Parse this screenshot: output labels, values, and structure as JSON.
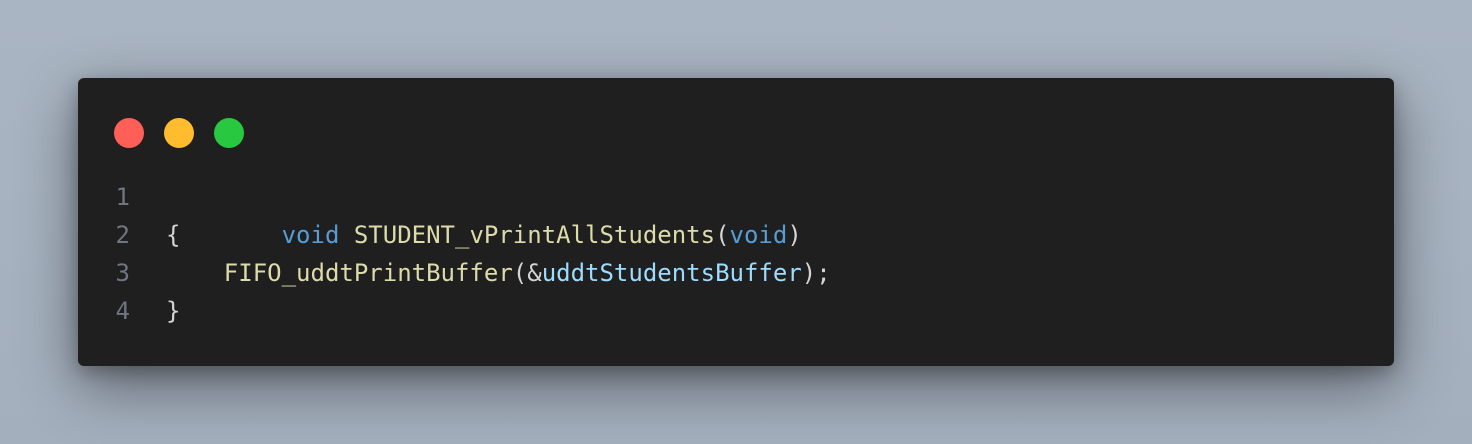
{
  "window": {
    "controls": [
      {
        "name": "close",
        "color": "#ff5f57"
      },
      {
        "name": "minimize",
        "color": "#febc2e"
      },
      {
        "name": "maximize",
        "color": "#28c840"
      }
    ]
  },
  "colors": {
    "background": "#1f1f1f",
    "keyword": "#569cd6",
    "function": "#dcdcaa",
    "plain": "#d4d4d4",
    "variable": "#9cdcfe",
    "line_number": "#6e7681"
  },
  "code": {
    "lines": [
      {
        "number": "1",
        "tokens": [
          {
            "text": "void",
            "type": "keyword"
          },
          {
            "text": " ",
            "type": "plain"
          },
          {
            "text": "STUDENT_vPrintAllStudents",
            "type": "function"
          },
          {
            "text": "(",
            "type": "plain"
          },
          {
            "text": "void",
            "type": "keyword"
          },
          {
            "text": ")",
            "type": "plain"
          }
        ]
      },
      {
        "number": "2",
        "tokens": [
          {
            "text": "{",
            "type": "plain"
          }
        ]
      },
      {
        "number": "3",
        "tokens": [
          {
            "text": "    ",
            "type": "plain"
          },
          {
            "text": "FIFO_uddtPrintBuffer",
            "type": "function"
          },
          {
            "text": "(&",
            "type": "plain"
          },
          {
            "text": "uddtStudentsBuffer",
            "type": "variable"
          },
          {
            "text": ");",
            "type": "plain"
          }
        ]
      },
      {
        "number": "4",
        "tokens": [
          {
            "text": "}",
            "type": "plain"
          }
        ]
      }
    ]
  }
}
